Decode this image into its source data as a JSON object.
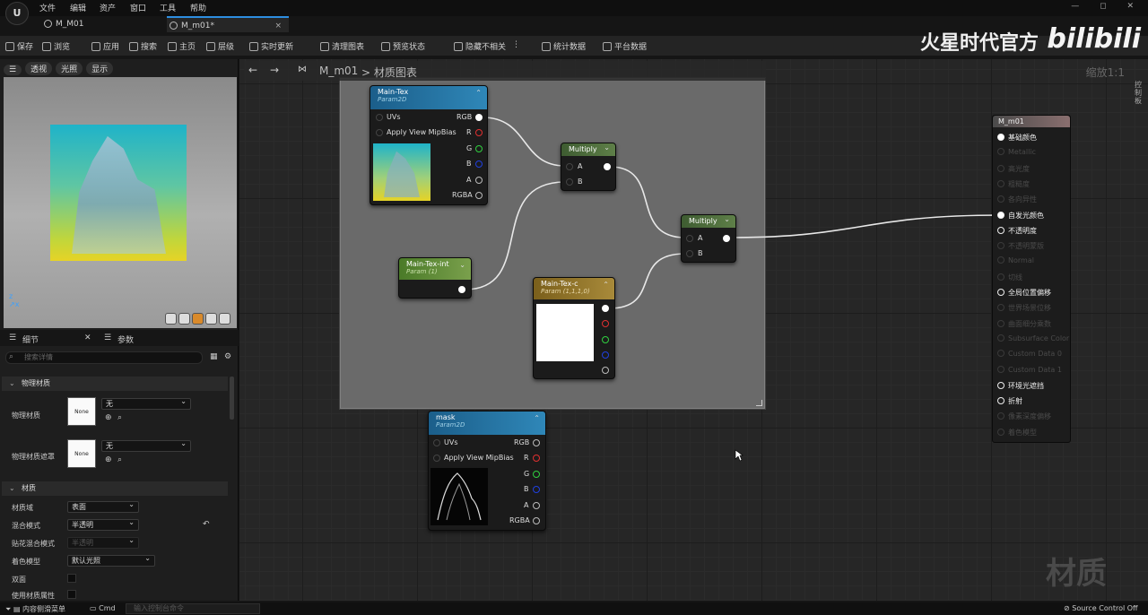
{
  "app": {
    "logo_text": "U",
    "menus": [
      "文件",
      "编辑",
      "资产",
      "窗口",
      "工具",
      "帮助"
    ],
    "window_controls": "— ◻ ✕"
  },
  "tabs": [
    {
      "label": "M_M01"
    },
    {
      "label": "M_m01*",
      "close": "×"
    }
  ],
  "toolbar": {
    "save": "保存",
    "browse": "浏览",
    "apply": "应用",
    "search": "搜索",
    "home": "主页",
    "hierarchy": "层级",
    "live_update": "实时更新",
    "clean_graph": "清理图表",
    "preview_state": "预览状态",
    "hide_unrelated": "隐藏不相关",
    "more": "⋮",
    "stats": "统计数据",
    "platform": "平台数据"
  },
  "overlay": {
    "brand": "火星时代官方",
    "bili": "bilibili",
    "watermark": "材质"
  },
  "viewport": {
    "mode": "透视",
    "lighting": "光照",
    "show": "显示",
    "menu_icon": "☰"
  },
  "details": {
    "tab_details": "细节",
    "tab_params": "参数",
    "close": "✕",
    "search_placeholder": "搜索详情",
    "sections": {
      "physical": "物理材质",
      "material": "材质"
    },
    "phys_material": "物理材质",
    "phys_mask": "物理材质遮罩",
    "none": "None",
    "none_val": "无",
    "props": [
      {
        "label": "材质域",
        "value": "表面"
      },
      {
        "label": "混合模式",
        "value": "半透明"
      },
      {
        "label": "贴花混合模式",
        "value": "半透明"
      },
      {
        "label": "着色模型",
        "value": "默认光照"
      },
      {
        "label": "双面",
        "value": ""
      },
      {
        "label": "使用材质属性",
        "value": ""
      }
    ],
    "reset": "↶"
  },
  "graph": {
    "title": "M_m01",
    "breadcrumb": "材质图表",
    "zoom": "缩放1:1",
    "back": "←",
    "forward": "→",
    "side_tab": "控制板"
  },
  "nodes": {
    "main_tex": {
      "title": "Main-Tex",
      "sub": "Param2D",
      "uvs": "UVs",
      "mip": "Apply View MipBias",
      "pins": [
        "RGB",
        "R",
        "G",
        "B",
        "A",
        "RGBA"
      ]
    },
    "multiply1": {
      "title": "Multiply",
      "a": "A",
      "b": "B"
    },
    "multiply2": {
      "title": "Multiply",
      "a": "A",
      "b": "B"
    },
    "tex_int": {
      "title": "Main-Tex-int",
      "sub": "Param (1)"
    },
    "tex_c": {
      "title": "Main-Tex-c",
      "sub": "Param (1,1,1,0)"
    },
    "mask": {
      "title": "mask",
      "sub": "Param2D",
      "uvs": "UVs",
      "mip": "Apply View MipBias",
      "pins": [
        "RGB",
        "R",
        "G",
        "B",
        "A",
        "RGBA"
      ]
    }
  },
  "output": {
    "title": "M_m01",
    "items": [
      {
        "label": "基础颜色",
        "state": "active"
      },
      {
        "label": "Metallic",
        "state": "dim"
      },
      {
        "label": "高光度",
        "state": "dim"
      },
      {
        "label": "粗糙度",
        "state": "dim"
      },
      {
        "label": "各向异性",
        "state": "dim"
      },
      {
        "label": "自发光颜色",
        "state": "active"
      },
      {
        "label": "不透明度",
        "state": "on"
      },
      {
        "label": "不透明蒙版",
        "state": "dim"
      },
      {
        "label": "Normal",
        "state": "dim"
      },
      {
        "label": "切线",
        "state": "dim"
      },
      {
        "label": "全局位置偏移",
        "state": "on"
      },
      {
        "label": "世界场景位移",
        "state": "dim"
      },
      {
        "label": "曲面细分乘数",
        "state": "dim"
      },
      {
        "label": "Subsurface Color",
        "state": "dim"
      },
      {
        "label": "Custom Data 0",
        "state": "dim"
      },
      {
        "label": "Custom Data 1",
        "state": "dim"
      },
      {
        "label": "环境光遮挡",
        "state": "on"
      },
      {
        "label": "折射",
        "state": "on"
      },
      {
        "label": "像素深度偏移",
        "state": "dim"
      },
      {
        "label": "着色模型",
        "state": "dim"
      }
    ]
  },
  "status": {
    "content_drawer": "内容侧滑菜单",
    "cmd": "Cmd",
    "cmd_placeholder": "输入控制台命令",
    "source_control": "Source Control Off"
  },
  "colors": {
    "accent": "#2d8ee0",
    "tex_header": "#1f6fa0",
    "scalar_header": "#4d7a2a",
    "vector_header": "#8a6a1d",
    "math_header": "#4d6a3a"
  }
}
